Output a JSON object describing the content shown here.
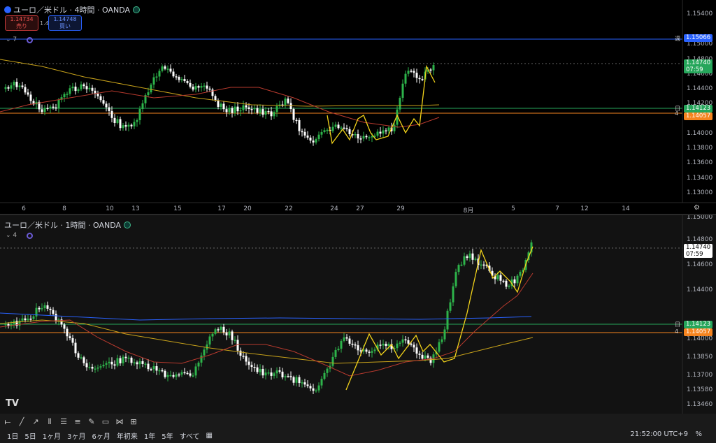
{
  "top": {
    "title": "ユーロ／米ドル · 4時間 · OANDA",
    "sell_price": "1.14734",
    "sell_label": "売り",
    "spread": "1.4",
    "buy_price": "1.14748",
    "buy_label": "買い",
    "indicator_count": "7",
    "price_labels": [
      "1.15400",
      "1.15000",
      "1.14800",
      "1.14600",
      "1.14400",
      "1.14200",
      "1.14000",
      "1.13800",
      "1.13600",
      "1.13400",
      "1.13200",
      "1.13000"
    ],
    "x_labels": [
      "6",
      "8",
      "10",
      "13",
      "15",
      "17",
      "20",
      "22",
      "24",
      "27",
      "29",
      "8月",
      "5",
      "7",
      "12",
      "14"
    ],
    "tag_week": {
      "text": "1.15066",
      "side": "週",
      "color": "#2962ff"
    },
    "tag_last": {
      "text": "1.14740",
      "sub": "07:59",
      "color": "#26a65b"
    },
    "tag_day": {
      "text": "1.14123",
      "side": "日",
      "color": "#26a65b"
    },
    "tag_4h": {
      "text": "1.14057",
      "side": "4",
      "color": "#f5841f"
    }
  },
  "bottom": {
    "title": "ユーロ／米ドル · 1時間 · OANDA",
    "indicator_count": "4",
    "price_labels": [
      "1.15000",
      "1.14800",
      "1.14600",
      "1.14400",
      "1.14200",
      "1.14000",
      "1.13850",
      "1.13700",
      "1.13580",
      "1.13460"
    ],
    "x_labels": [
      "0",
      "25",
      "12:00",
      "28",
      "12:00",
      "29",
      "12:00",
      "30",
      "12:00",
      "31",
      "12:00",
      "8月",
      "12:0"
    ],
    "tag_last": {
      "text": "1.14740",
      "sub": "07:59",
      "color": "#ffffff"
    },
    "tag_day": {
      "text": "1.14123",
      "side": "日",
      "color": "#26a65b"
    },
    "tag_4h": {
      "text": "1.14057",
      "side": "4",
      "color": "#f5841f"
    },
    "tradingview_logo": "TV"
  },
  "footer": {
    "ranges": [
      "1日",
      "5日",
      "1ヶ月",
      "3ヶ月",
      "6ヶ月",
      "年初来",
      "1年",
      "5年",
      "すべて"
    ],
    "clock": "21:52:00 UTC+9",
    "adj": "%"
  },
  "colors": {
    "up": "#2db34a",
    "down": "#ffffff",
    "ma_slow": "#c8a21a",
    "ma_fast": "#b83a2e",
    "zigzag": "#f2d31a",
    "weekly": "#2962ff",
    "daily": "#26a65b",
    "fourh": "#f5841f"
  }
}
